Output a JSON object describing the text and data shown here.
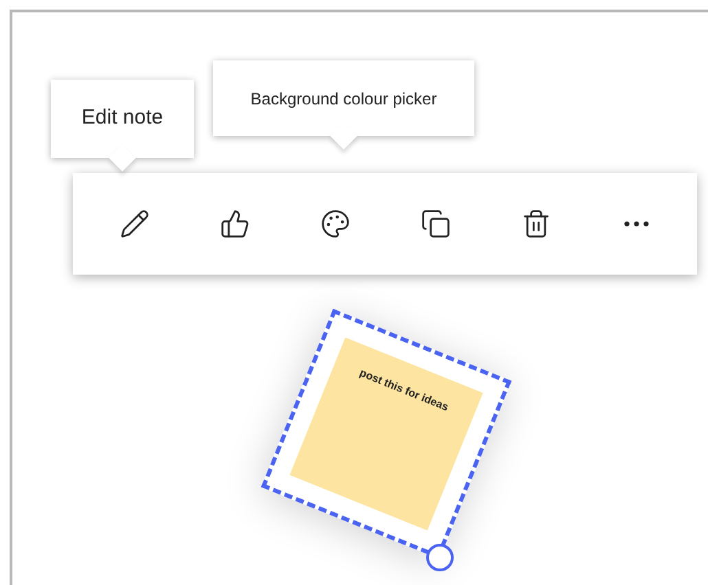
{
  "tooltips": [
    {
      "text": "Edit note"
    },
    {
      "text": "Background colour picker"
    }
  ],
  "toolbar": {
    "buttons": [
      {
        "kind": "edit"
      },
      {
        "kind": "like"
      },
      {
        "kind": "color"
      },
      {
        "kind": "copy"
      },
      {
        "kind": "delete"
      },
      {
        "kind": "more"
      }
    ]
  },
  "note": {
    "text": "post this for ideas",
    "selected": true
  }
}
